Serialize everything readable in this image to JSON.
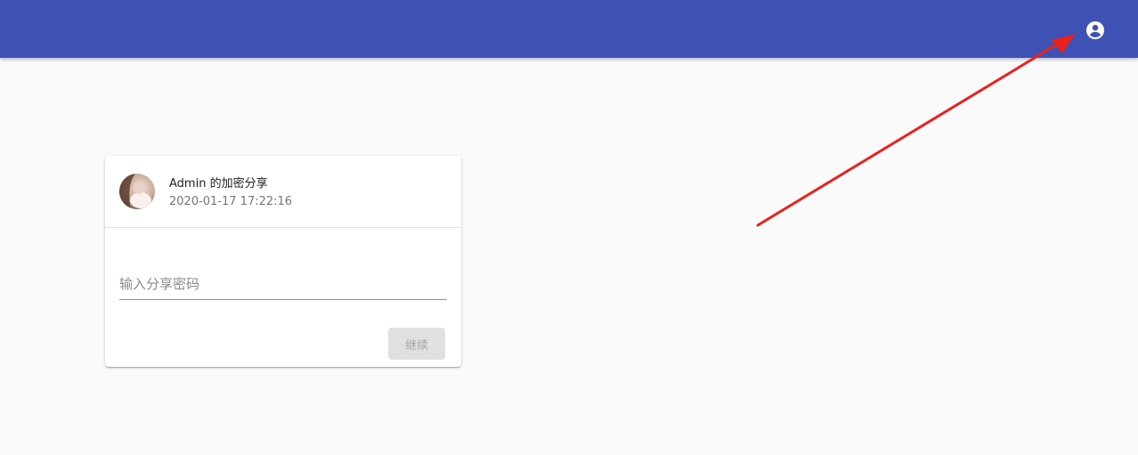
{
  "appbar": {
    "color": "#3f51b5",
    "account_icon": "account-circle-icon"
  },
  "share_card": {
    "title": "Admin 的加密分享",
    "timestamp": "2020-01-17 17:22:16",
    "avatar_icon": "user-avatar",
    "password_input": {
      "placeholder": "输入分享密码",
      "value": ""
    },
    "continue_label": "继续"
  },
  "annotation": {
    "arrow_color": "#e8231d",
    "target": "account-circle-icon"
  }
}
